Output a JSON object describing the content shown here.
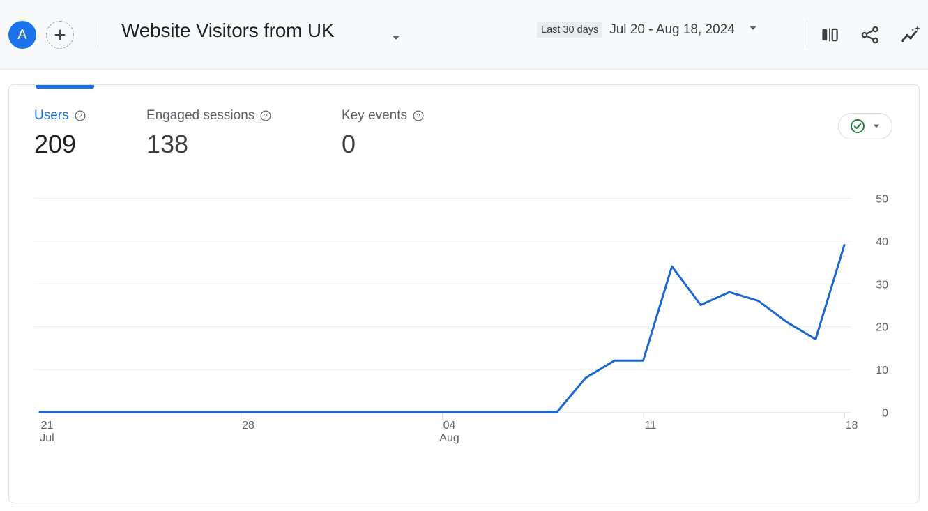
{
  "topbar": {
    "avatar_letter": "A",
    "avatar_color": "#1a73e8",
    "add_icon": "plus-icon",
    "property_title": "Website Visitors from UK",
    "title_caret_icon": "chevron-down-icon",
    "date_chip": "Last 30 days",
    "date_range": "Jul 20 - Aug 18, 2024",
    "date_caret_icon": "chevron-down-icon",
    "icons": [
      {
        "name": "compare-icon",
        "label": "Comparisons"
      },
      {
        "name": "share-icon",
        "label": "Share this report"
      },
      {
        "name": "insights-icon",
        "label": "Insights"
      }
    ]
  },
  "card": {
    "status": {
      "icon": "check-circle-icon",
      "icon_color": "#188038",
      "caret_icon": "chevron-down-icon"
    },
    "metrics": [
      {
        "label": "Users",
        "value": "209",
        "help_icon": "help-circle-icon",
        "active": true
      },
      {
        "label": "Engaged sessions",
        "value": "138",
        "help_icon": "help-circle-icon",
        "active": false
      },
      {
        "label": "Key events",
        "value": "0",
        "help_icon": "help-circle-icon",
        "active": false
      }
    ]
  },
  "chart_data": {
    "type": "line",
    "title": "",
    "xlabel": "",
    "ylabel": "",
    "series": [
      {
        "name": "Users",
        "color": "#1967d2",
        "values": [
          0,
          0,
          0,
          0,
          0,
          0,
          0,
          0,
          0,
          0,
          0,
          0,
          0,
          0,
          0,
          0,
          0,
          0,
          0,
          8,
          12,
          12,
          34,
          25,
          28,
          26,
          21,
          17,
          39
        ]
      }
    ],
    "x": [
      "Jul 21",
      "Jul 22",
      "Jul 23",
      "Jul 24",
      "Jul 25",
      "Jul 26",
      "Jul 27",
      "Jul 28",
      "Jul 29",
      "Jul 30",
      "Jul 31",
      "Aug 01",
      "Aug 02",
      "Aug 03",
      "Aug 04",
      "Aug 05",
      "Aug 06",
      "Aug 07",
      "Aug 08",
      "Aug 09",
      "Aug 10",
      "Aug 11",
      "Aug 12",
      "Aug 13",
      "Aug 14",
      "Aug 15",
      "Aug 16",
      "Aug 17",
      "Aug 18"
    ],
    "xticks": [
      {
        "index": 0,
        "line1": "21",
        "line2": "Jul"
      },
      {
        "index": 7,
        "line1": "28",
        "line2": ""
      },
      {
        "index": 14,
        "line1": "04",
        "line2": "Aug"
      },
      {
        "index": 21,
        "line1": "11",
        "line2": ""
      },
      {
        "index": 28,
        "line1": "18",
        "line2": ""
      }
    ],
    "yticks": [
      "50",
      "40",
      "30",
      "20",
      "10",
      "0"
    ],
    "ylim": [
      0,
      50
    ],
    "grid": true,
    "legend": "none"
  }
}
